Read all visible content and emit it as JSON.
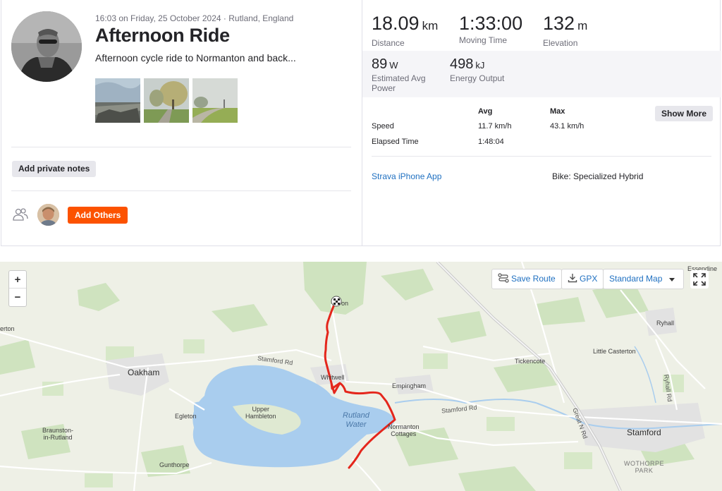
{
  "activity": {
    "meta": "16:03 on Friday, 25 October 2024 · Rutland, England",
    "title": "Afternoon Ride",
    "description": "Afternoon cycle ride to Normanton and back..."
  },
  "actions": {
    "private_notes": "Add private notes",
    "add_others": "Add Others",
    "show_more": "Show More"
  },
  "stats": {
    "distance": {
      "value": "18.09",
      "unit": "km",
      "label": "Distance"
    },
    "moving_time": {
      "value": "1:33:00",
      "label": "Moving Time"
    },
    "elevation": {
      "value": "132",
      "unit": "m",
      "label": "Elevation"
    },
    "power": {
      "value": "89",
      "unit": "W",
      "label_line1": "Estimated Avg",
      "label_line2": "Power"
    },
    "energy": {
      "value": "498",
      "unit": "kJ",
      "label": "Energy Output"
    }
  },
  "table": {
    "headers": {
      "avg": "Avg",
      "max": "Max"
    },
    "rows": [
      {
        "label": "Speed",
        "avg": "11.7 km/h",
        "max": "43.1 km/h"
      },
      {
        "label": "Elapsed Time",
        "avg": "1:48:04",
        "max": ""
      }
    ]
  },
  "device": "Strava iPhone App",
  "bike": "Bike: Specialized Hybrid",
  "map": {
    "zoom_in": "+",
    "zoom_out": "−",
    "save_route": "Save Route",
    "gpx": "GPX",
    "map_type": "Standard Map",
    "places": {
      "oakham": "Oakham",
      "whitwell": "Whitwell",
      "empingham": "Empingham",
      "tickencote": "Tickencote",
      "little_casterton": "Little Casterton",
      "ryhall": "Ryhall",
      "stamford": "Stamford",
      "egleton": "Egleton",
      "upper_hambleton": "Upper\nHambleton",
      "braunston": "Braunston-\nin-Rutland",
      "gunthorpe": "Gunthorpe",
      "normanton": "Normanton\nCottages",
      "wothorpe": "WOTHORPE\nPARK",
      "erton": "erton",
      "esendine": "Essendine",
      "start_label": "on"
    },
    "water": "Rutland\nWater",
    "roads": {
      "stamford_rd_1": "Stamford Rd",
      "stamford_rd_2": "Stamford Rd",
      "great_n_rd": "Great N Rd",
      "ryhall_rd": "Ryhall Rd"
    }
  },
  "colors": {
    "accent": "#fc5200",
    "link": "#1f70c1",
    "route": "#e4261c",
    "water": "#a9cdee"
  }
}
